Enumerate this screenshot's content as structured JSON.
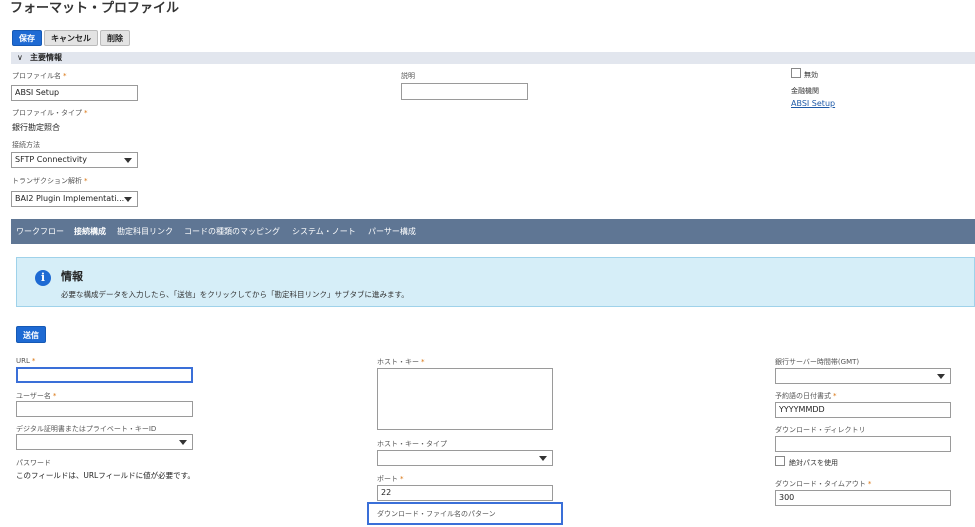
{
  "page": {
    "title": "フォーマット・プロファイル"
  },
  "toolbar": {
    "save_label": "保存",
    "cancel_label": "キャンセル",
    "delete_label": "削除"
  },
  "main_section": {
    "title": "主要情報"
  },
  "fields": {
    "profile_name": {
      "label": "プロファイル名",
      "value": "ABSI Setup"
    },
    "profile_type": {
      "label": "プロファイル・タイプ",
      "value": "銀行勘定照合"
    },
    "connection_method": {
      "label": "接続方法",
      "value": "SFTP Connectivity"
    },
    "transaction_parse": {
      "label": "トランザクション解析",
      "value": "BAI2 Plugin Implementati..."
    },
    "description": {
      "label": "説明",
      "value": ""
    },
    "inactive": {
      "label": "無効",
      "checked": false
    },
    "financial_institution": {
      "label": "金融機関",
      "value": "ABSI Setup"
    }
  },
  "tabs": [
    {
      "label": "ワークフロー",
      "active": false
    },
    {
      "label": "接続構成",
      "active": true
    },
    {
      "label": "勘定科目リンク",
      "active": false
    },
    {
      "label": "コードの種類のマッピング",
      "active": false
    },
    {
      "label": "システム・ノート",
      "active": false
    },
    {
      "label": "パーサー構成",
      "active": false
    }
  ],
  "info": {
    "title": "情報",
    "message": "必要な構成データを入力したら、「送信」をクリックしてから「勘定科目リンク」サブタブに進みます。"
  },
  "connection": {
    "submit_label": "送信",
    "url": {
      "label": "URL",
      "value": ""
    },
    "username": {
      "label": "ユーザー名",
      "value": ""
    },
    "cert_key": {
      "label": "デジタル証明書またはプライベート・キーID",
      "value": ""
    },
    "password": {
      "label": "パスワード",
      "note": "このフィールドは、URLフィールドに値が必要です。"
    },
    "host_key": {
      "label": "ホスト・キー",
      "value": ""
    },
    "host_key_type": {
      "label": "ホスト・キー・タイプ",
      "value": ""
    },
    "port": {
      "label": "ポート",
      "value": "22"
    },
    "filename_pattern": {
      "label": "ダウンロード・ファイル名のパターン"
    },
    "bank_timezone": {
      "label": "銀行サーバー時間帯(GMT)",
      "value": ""
    },
    "date_format": {
      "label": "予約語の日付書式",
      "value": "YYYYMMDD"
    },
    "download_dir": {
      "label": "ダウンロード・ディレクトリ",
      "value": ""
    },
    "absolute_path": {
      "label": "絶対パスを使用",
      "checked": false
    },
    "timeout": {
      "label": "ダウンロード・タイムアウト",
      "value": "300"
    }
  },
  "colors": {
    "accent": "#1e6ad3",
    "tabbar": "#5f7694",
    "required": "#d9730d",
    "info_bg": "#d6eef8",
    "highlight": "#3a6fd8"
  }
}
